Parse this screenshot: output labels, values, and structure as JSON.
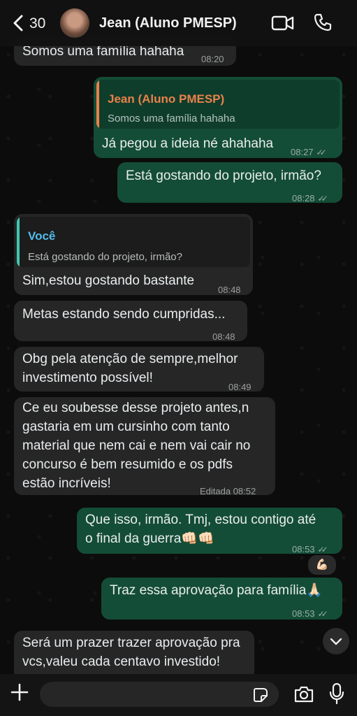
{
  "header": {
    "back_count": "30",
    "contact_name": "Jean (Aluno PMESP)"
  },
  "messages": [
    {
      "text": "Somos uma família hahaha",
      "time": "08:20"
    },
    {
      "quote_name": "Jean (Aluno PMESP)",
      "quote_text": "Somos uma família hahaha",
      "text": "Já pegou a ideia né ahahaha",
      "time": "08:27"
    },
    {
      "text": "Está gostando do projeto, irmão?",
      "time": "08:28"
    },
    {
      "quote_name": "Você",
      "quote_text": "Está gostando do projeto, irmão?",
      "text": "Sim,estou gostando bastante",
      "time": "08:48"
    },
    {
      "text": "Metas estando sendo cumpridas...",
      "time": "08:48"
    },
    {
      "text": "Obg pela atenção de sempre,melhor\ninvestimento possível!",
      "time": "08:49"
    },
    {
      "text": "Ce eu soubesse desse projeto antes,n\ngastaria em um cursinho com tanto\nmaterial que nem cai e nem vai cair no\nconcurso é bem resumido e os pdfs\nestão incríveis!",
      "time": "Editada 08:52"
    },
    {
      "text": "Que isso, irmão. Tmj, estou contigo até\no final da guerra👊🏻👊🏻",
      "time": "08:53",
      "reaction": "💪🏻"
    },
    {
      "text": "Traz essa aprovação para família🙏🏻",
      "time": "08:53"
    },
    {
      "text": "Será um prazer trazer aprovação pra\nvcs,valeu cada centavo investido!"
    }
  ],
  "colors": {
    "incoming": "#262626",
    "outgoing": "#144d37",
    "quote_name_jean": "#e9814a",
    "quote_name_you": "#53bdeb",
    "quote_bar_jean": "#e9814a",
    "quote_bar_you": "#41c7b0"
  },
  "icons": [
    "back-chevron-icon",
    "video-call-icon",
    "phone-icon",
    "plus-icon",
    "sticker-icon",
    "camera-icon",
    "microphone-icon",
    "chevron-down-icon"
  ]
}
